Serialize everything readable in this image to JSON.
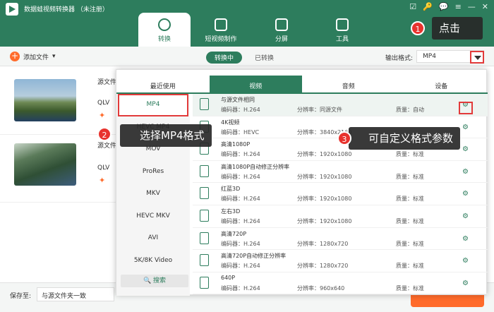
{
  "app": {
    "title": "数据蛙视频转换器 （未注册）"
  },
  "window_icons": [
    "☑",
    "🔑",
    "💬",
    "≡",
    "—",
    "✕"
  ],
  "tabs": [
    {
      "label": "转换",
      "icon": "convert-icon"
    },
    {
      "label": "短视频制作",
      "icon": "video-icon"
    },
    {
      "label": "分屏",
      "icon": "split-icon"
    },
    {
      "label": "工具",
      "icon": "toolbox-icon"
    }
  ],
  "toolbar": {
    "add_label": "添加文件",
    "seg_converting": "转换中",
    "seg_converted": "已转换",
    "output_format_label": "输出格式:",
    "output_format_value": "MP4"
  },
  "files": [
    {
      "src": "源文件",
      "qlv": "QLV"
    },
    {
      "src": "源文件",
      "qlv": "QLV"
    }
  ],
  "bottom": {
    "save_label": "保存至:",
    "save_path": "与源文件夹一致"
  },
  "panel": {
    "tabs": [
      "最近使用",
      "视频",
      "音频",
      "设备"
    ],
    "formats": [
      "MP4",
      "HEVC MP4",
      "MOV",
      "ProRes",
      "MKV",
      "HEVC MKV",
      "AVI",
      "5K/8K Video"
    ],
    "search": "搜索",
    "presets": [
      {
        "name": "与源文件相同",
        "codec": "编码器：H.264",
        "res": "分辨率：同源文件",
        "quality": "质量：自动"
      },
      {
        "name": "4K视频",
        "codec": "编码器：HEVC",
        "res": "分辨率：3840x2160",
        "quality": ""
      },
      {
        "name": "高清1080P",
        "codec": "编码器：H.264",
        "res": "分辨率：1920x1080",
        "quality": "质量：标准"
      },
      {
        "name": "高清1080P自动修正分辨率",
        "codec": "编码器：H.264",
        "res": "分辨率：1920x1080",
        "quality": "质量：标准"
      },
      {
        "name": "红蓝3D",
        "codec": "编码器：H.264",
        "res": "分辨率：1920x1080",
        "quality": "质量：标准"
      },
      {
        "name": "左右3D",
        "codec": "编码器：H.264",
        "res": "分辨率：1920x1080",
        "quality": "质量：标准"
      },
      {
        "name": "高清720P",
        "codec": "编码器：H.264",
        "res": "分辨率：1280x720",
        "quality": "质量：标准"
      },
      {
        "name": "高清720P自动修正分辨率",
        "codec": "编码器：H.264",
        "res": "分辨率：1280x720",
        "quality": "质量：标准"
      },
      {
        "name": "640P",
        "codec": "编码器：H.264",
        "res": "分辨率：960x640",
        "quality": "质量：标准"
      }
    ]
  },
  "annotations": {
    "tip1_num": "1",
    "tip1": "点击",
    "tip2_num": "2",
    "tip2": "选择MP4格式",
    "tip3_num": "3",
    "tip3": "可自定义格式参数"
  },
  "colors": {
    "brand": "#2d7d5d",
    "accent": "#ff6b2b",
    "highlight": "#e23a3a"
  }
}
